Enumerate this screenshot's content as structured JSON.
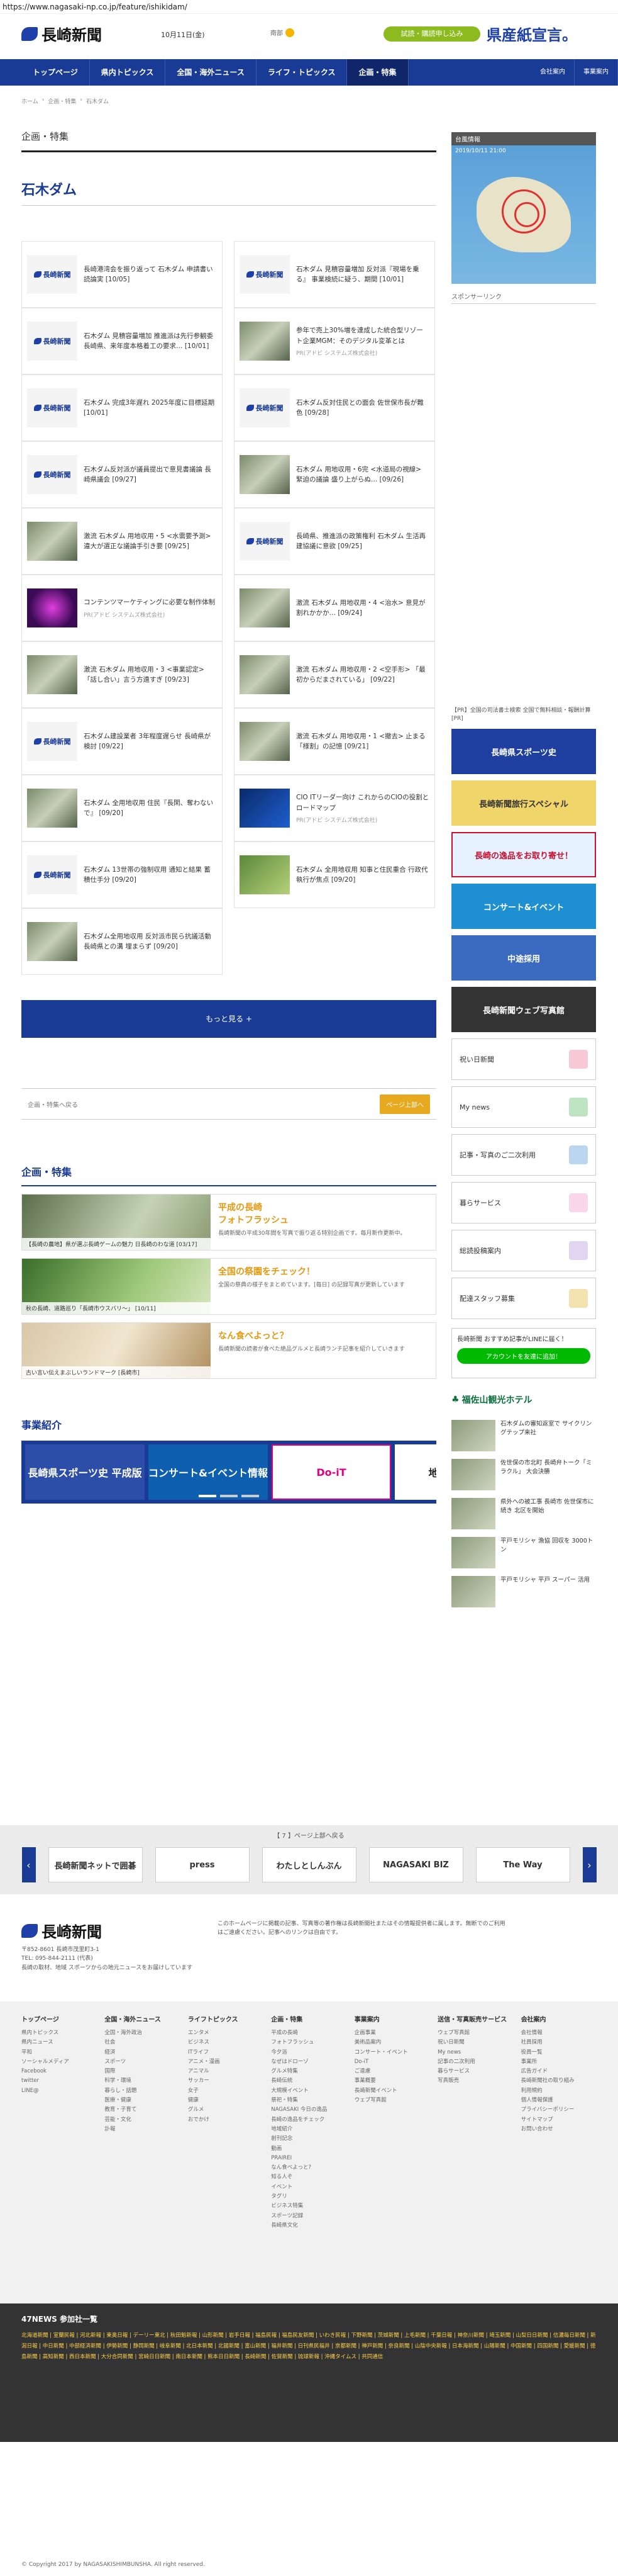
{
  "browser": {
    "url": "https://www.nagasaki-np.co.jp/feature/ishikidam/"
  },
  "header": {
    "logo": "長崎新聞",
    "date": "10月11日(金)",
    "weather": "南部",
    "trial_button": "試読・購読申し込み",
    "banner": "県産紙宣言。"
  },
  "nav": {
    "items": [
      "トップページ",
      "県内トピックス",
      "全国・海外ニュース",
      "ライフ・トピックス",
      "企画・特集"
    ],
    "right": [
      "会社案内",
      "事業案内"
    ]
  },
  "breadcrumb": [
    "ホーム",
    "企画・特集",
    "石木ダム"
  ],
  "main": {
    "section": "企画・特集",
    "title": "石木ダム",
    "cards": [
      {
        "text": "長崎港湾会を振り返って 石木ダム 申請書い読論実 [10/05]",
        "thumb": "長崎新聞"
      },
      {
        "text": "石木ダム 見積容量増加 反対派『現場を乗る』 事業検続に疑う、期間 [10/01]",
        "thumb": "長崎新聞"
      },
      {
        "text": "石木ダム 見積容量増加 推進派は先行参観委 長崎県、来年度本格着工の要求… [10/01]",
        "thumb": "長崎新聞"
      },
      {
        "text": "参年で売上30%増を達成した統合型リゾート企業MGM：そのデジタル変革とは",
        "sub": "PR(アドビ システムズ株式会社)",
        "thumb": "photo"
      },
      {
        "text": "石木ダム 完成3年遅れ 2025年度に目標延期 [10/01]",
        "thumb": "長崎新聞"
      },
      {
        "text": "石木ダム反対住民との面会 佐世保市長が難色 [09/28]",
        "thumb": "長崎新聞"
      },
      {
        "text": "石木ダム反対派が議員提出で意見書議論 長崎県議会 [09/27]",
        "thumb": "長崎新聞"
      },
      {
        "text": "石木ダム 用地収用・6完 <水道局の視線> 緊迫の議論 盛り上がらぬ… [09/26]",
        "thumb": "photo"
      },
      {
        "text": "激流 石木ダム 用地収用・5 <水需要予測> 違大が選正な議論手引き要 [09/25]",
        "thumb": "photo"
      },
      {
        "text": "長崎県、推進派の政策権利 石木ダム 生活再建協議に意欲 [09/25]",
        "thumb": "長崎新聞"
      },
      {
        "text": "コンテンツマーケティングに必要な制作体制",
        "sub": "PR(アドビ システムズ株式会社)",
        "thumb": "purple"
      },
      {
        "text": "激流 石木ダム 用地収用・4 <治水> 意見が割れかかか… [09/24]",
        "thumb": "photo"
      },
      {
        "text": "激流 石木ダム 用地収用・3 <事業認定> 「話し合い」言う方遠すぎ [09/23]",
        "thumb": "photo"
      },
      {
        "text": "激流 石木ダム 用地収用・2 <空手形> 「最初からだまされている」 [09/22]",
        "thumb": "photo"
      },
      {
        "text": "石木ダム建設業者 3年程度遅らせ 長崎県が検討 [09/22]",
        "thumb": "長崎新聞"
      },
      {
        "text": "激流 石木ダム 用地収用・1 <撤去> 止まる「様割」の記憶 [09/21]",
        "thumb": "photo"
      },
      {
        "text": "石木ダム 全用地収用 住民『長閑、奪わないで』 [09/20]",
        "thumb": "photo"
      },
      {
        "text": "CIO ITリーダー向け これからのCIOの役割とロードマップ",
        "sub": "PR(アドビ システムズ株式会社)",
        "thumb": "blue"
      },
      {
        "text": "石木ダム 13世帯の強制収用 通知と結果 蓄積仕手分 [09/20]",
        "thumb": "長崎新聞"
      },
      {
        "text": "石木ダム 全用地収用 知事と住民重合 行政代執行が焦点 [09/20]",
        "thumb": "green"
      },
      {
        "text": "石木ダム全用地収用 反対派市民ら抗議活動 長崎県との溝 埋まらず [09/20]",
        "thumb": "photo"
      }
    ],
    "more_button": "もっと見る +",
    "pager_link": "企画・特集へ戻る",
    "top_button": "ページ上部へ",
    "feature_heading": "企画・特集",
    "features": [
      {
        "caption": "【長崎の農地】県が選ぶ長崎ゲームの魅力 日長崎のわな道 [03/17]",
        "title": "平成の長崎\nフォトフラッシュ",
        "desc": "長崎新聞の平成30年間を写真で振り返る特別企画です。毎月新作更新中。"
      },
      {
        "caption": "秋の長崎、道路巡り「長崎市ウスバリ～」 [10/11]",
        "title": "全国の祭園をチェック！",
        "desc": "全国の祭典の様子をまとめています。[毎日] の記録写真が更新しています"
      },
      {
        "caption": "古い言い伝えまぶしいランドマーク [長崎市]",
        "title": "なん食べよっと？",
        "desc": "長崎新聞の読者が食べた絶品グルメと長崎ランチ記事を紹介していきます"
      }
    ],
    "business_heading": "事業紹介",
    "business": [
      "長崎県スポーツ史 平成版",
      "コンサート&イベント情報",
      "Do-iT",
      "地域×クFA"
    ]
  },
  "sidebar": {
    "map_label": "台風情報",
    "map_date": "2019/10/11 21:00",
    "sponsor": "スポンサーリンク",
    "side_news": "【PR】全国の司法書士検索 全国で無料相談・報酬計算 [PR]",
    "banners": [
      "長崎県スポーツ史",
      "長崎新聞旅行スペシャル",
      "長崎の逸品をお取り寄せ！",
      "コンサート&イベント",
      "中途採用",
      "長崎新聞ウェブ写真館"
    ],
    "buttons": [
      "祝い日新聞",
      "My news",
      "記事・写真のご二次利用",
      "暮らサービス",
      "総読投稿案内",
      "配達スタッフ募集"
    ],
    "line_title": "長崎新聞 おすすめ記事がLINEに届く！",
    "line_btn": "アカウントを友達に追加！",
    "hotel": "福佐山観光ホテル",
    "news": [
      "石木ダムの審知返室で サイクリングテップ来社",
      "佐世保の市北町 長崎弁トーク「ミラクル」 大会決勝",
      "県外への被工事 長崎市 佐世保市に続き 北区を開始",
      "平戸モリシャ 漁協 回収を 3000トン",
      "平戸モリシャ 平戸 スーパー 活用"
    ]
  },
  "partners": {
    "title": "【 7 】ページ上部へ戻る",
    "items": [
      "長崎新聞ネットで囲碁",
      "press",
      "わたしとしんぶん",
      "NAGASAKI BIZ",
      "The Way"
    ]
  },
  "footer": {
    "logo": "長崎新聞",
    "address": "〒852-8601 長崎市茂里町3-1\nTEL: 095-844-2111 (代表)",
    "tagline": "長崎の取材、地域 スポーツからの地元ニュースをお届けしています",
    "note": "このホームページに掲載の記事、写真等の著作権は長崎新聞社またはその情報提供者に属します。無断でのご利用はご遠慮ください。記事へのリンクは自由です。",
    "columns": [
      {
        "title": "トップページ",
        "items": [
          "県内トピックス",
          "県内ニュース",
          "平和",
          "ソーシャルメディア",
          "Facebook",
          "twitter",
          "LINE@"
        ]
      },
      {
        "title": "全国・海外ニュース",
        "items": [
          "全国・海外政治",
          "社会",
          "経済",
          "スポーツ",
          "国際",
          "科学・環境",
          "暮らし・話題",
          "医療・健康",
          "教育・子育て",
          "芸能・文化",
          "訃報"
        ]
      },
      {
        "title": "ライフトピックス",
        "items": [
          "エンタメ",
          "ビジネス",
          "ITライフ",
          "アニメ・漫画",
          "アニマル",
          "サッカー",
          "女子",
          "健康",
          "グルメ",
          "おでかけ"
        ]
      },
      {
        "title": "企画・特集",
        "items": [
          "平成の長崎",
          "フォトフラッシュ",
          "今夕浴",
          "なぜはドローゾ",
          "グルメ特集",
          "長崎伝統",
          "大規模イベント",
          "祭祀・特集",
          "NAGASAKI 今日の逸品",
          "長崎の逸品をチェック",
          "地域紹介",
          "創刊記念",
          "動画",
          "PRAIREI",
          "なん食べよっと?",
          "知る人ぞ",
          "イベント",
          "タグリ",
          "ビジネス特集",
          "スポーツ記録",
          "長崎県文化"
        ]
      },
      {
        "title": "事業案内",
        "items": [
          "企画事業",
          "美術品案内",
          "コンサート・イベント",
          "Do-iT",
          "ご遠慮",
          "事業概要",
          "長崎新聞イベント",
          "ウェブ写真館"
        ]
      },
      {
        "title": "送信・写真販売サービス",
        "items": [
          "ウェブ写真館",
          "祝い日新聞",
          "My news",
          "記事の二次利用",
          "暮らサービス",
          "写真販売"
        ]
      },
      {
        "title": "会社案内",
        "items": [
          "会社情報",
          "社員採用",
          "役員一覧",
          "事業所",
          "広告ガイド",
          "長崎新聞社の取り組み",
          "利用規約",
          "個人情報保護",
          "プライバシーポリシー",
          "サイトマップ",
          "お問い合わせ"
        ]
      }
    ],
    "bottom_title": "47NEWS 参加社一覧",
    "bottom_links": "北海道新聞 | 室蘭民報 | 河北新報 | 東奥日報 | デーリー東北 | 秋田魁新報 | 山形新聞 | 岩手日報 | 福島民報 | 福島民友新聞 | いわき民報 | 下野新聞 | 茨城新聞 | 上毛新聞 | 千葉日報 | 神奈川新聞 | 埼玉新聞 | 山梨日日新聞 | 信濃毎日新聞 | 新潟日報 | 中日新聞 | 中部経済新聞 | 伊勢新聞 | 静岡新聞 | 岐阜新聞 | 北日本新聞 | 北國新聞 | 富山新聞 | 福井新聞 | 日刊県民福井 | 京都新聞 | 神戸新聞 | 奈良新聞 | 山陰中央新報 | 日本海新聞 | 山陽新聞 | 中国新聞 | 四国新聞 | 愛媛新聞 | 徳島新聞 | 高知新聞 | 西日本新聞 | 大分合同新聞 | 宮崎日日新聞 | 南日本新聞 | 熊本日日新聞 | 長崎新聞 | 佐賀新聞 | 琉球新報 | 沖縄タイムス | 共同通信",
    "copyright": "© Copyright 2017 by NAGASAKISHIMBUNSHA. All right reserved."
  }
}
